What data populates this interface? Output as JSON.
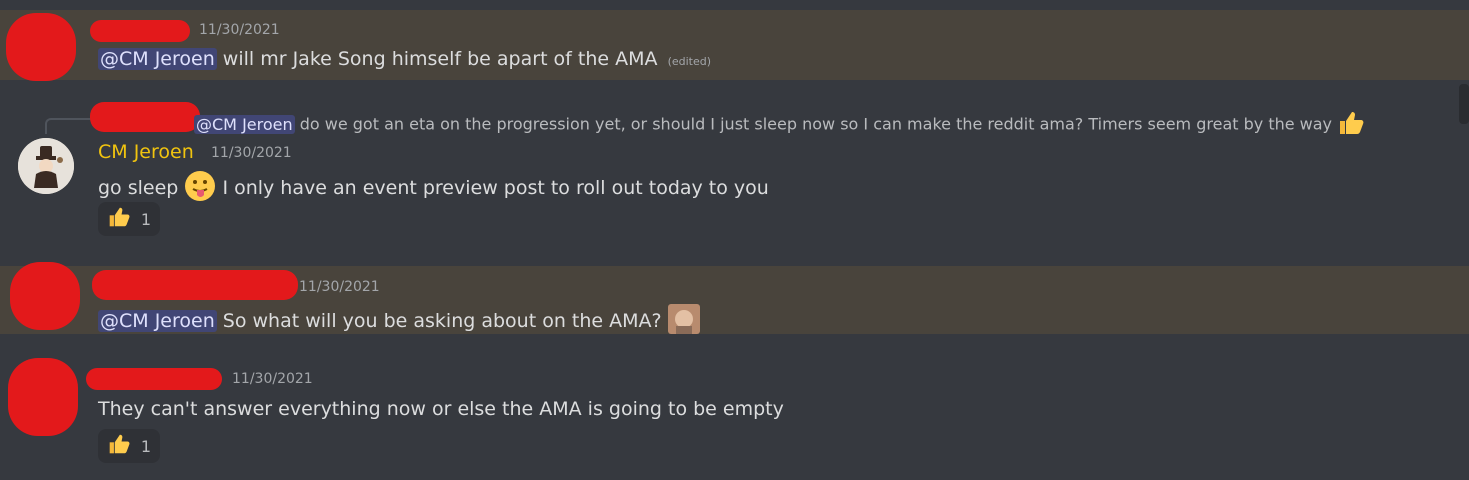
{
  "messages": [
    {
      "timestamp": "11/30/2021",
      "mention": "@CM Jeroen",
      "text": "will mr Jake Song himself be apart of the AMA",
      "edited": "(edited)"
    },
    {
      "reply": {
        "mention": "@CM Jeroen",
        "text": "do we got an eta on the progression yet, or should I just sleep now so I can make the reddit ama?   Timers seem great by the way"
      },
      "author": "CM Jeroen",
      "timestamp": "11/30/2021",
      "text_before": "go sleep",
      "text_after": "I only have an event preview post to roll out today to you",
      "reaction": {
        "emoji": "thumbs-up-icon",
        "count": "1"
      }
    },
    {
      "timestamp": "11/30/2021",
      "mention": "@CM Jeroen",
      "text": "So what will you be asking about on the AMA?"
    },
    {
      "timestamp": "11/30/2021",
      "text": "They can't answer everything now or else the AMA is going to be empty",
      "reaction": {
        "emoji": "thumbs-up-icon",
        "count": "1"
      }
    }
  ],
  "colors": {
    "background": "#36393f",
    "highlight": "#49443c",
    "mention_bg": "#414675",
    "author_name": "#f1c40f",
    "redaction": "#e3191b"
  }
}
